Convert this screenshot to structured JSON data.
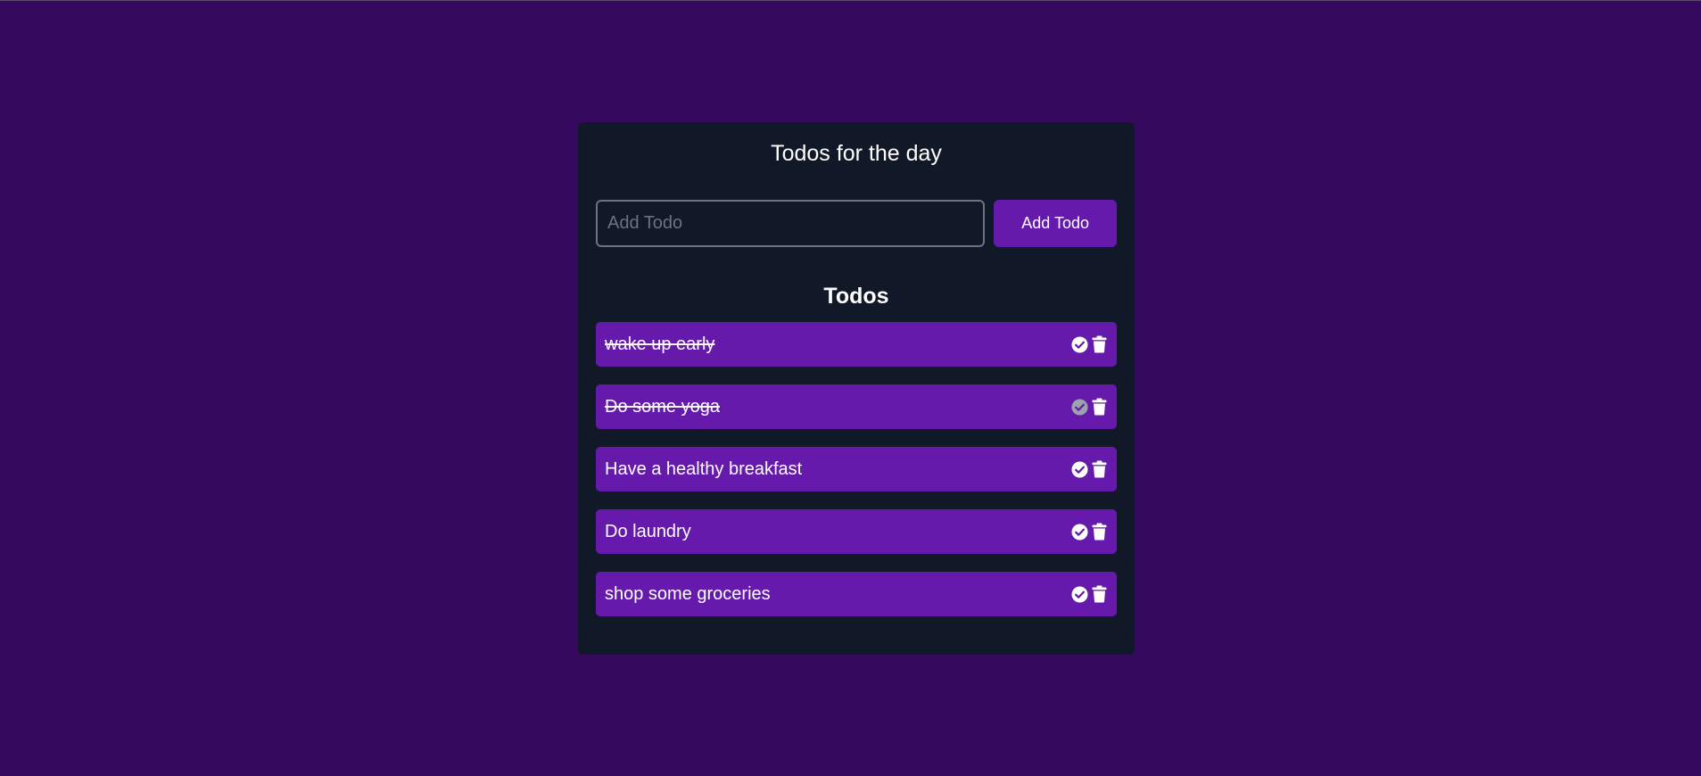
{
  "app": {
    "title": "Todos for the day"
  },
  "add_form": {
    "input_value": "",
    "placeholder": "Add Todo",
    "button_label": "Add Todo"
  },
  "list": {
    "heading": "Todos",
    "items": [
      {
        "text": "wake up early",
        "completed": true,
        "check_icon": "check-circle-icon",
        "delete_icon": "trash-icon",
        "check_color": "#ffffff"
      },
      {
        "text": "Do some yoga",
        "completed": true,
        "check_icon": "check-circle-icon",
        "delete_icon": "trash-icon",
        "check_color": "#9ca3af"
      },
      {
        "text": "Have a healthy breakfast",
        "completed": false,
        "check_icon": "check-circle-icon",
        "delete_icon": "trash-icon",
        "check_color": "#ffffff"
      },
      {
        "text": "Do laundry",
        "completed": false,
        "check_icon": "check-circle-icon",
        "delete_icon": "trash-icon",
        "check_color": "#ffffff"
      },
      {
        "text": "shop some groceries",
        "completed": false,
        "check_icon": "check-circle-icon",
        "delete_icon": "trash-icon",
        "check_color": "#ffffff"
      }
    ]
  },
  "colors": {
    "background": "#35095d",
    "card": "#111827",
    "accent": "#651aab",
    "text": "#ffffff",
    "muted_icon": "#9ca3af"
  }
}
